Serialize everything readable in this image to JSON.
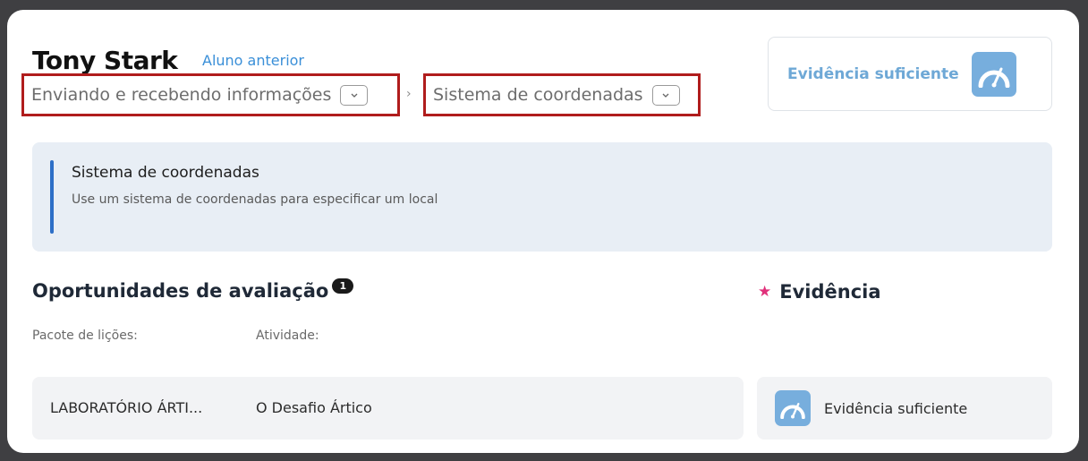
{
  "student": {
    "name": "Tony Stark",
    "prev_link": "Aluno anterior"
  },
  "breadcrumb": {
    "level1": "Enviando e recebendo informações",
    "separator": "›",
    "level2": "Sistema de coordenadas",
    "dropdown_icon": "chevron-down-icon"
  },
  "evidence_summary": {
    "label": "Evidência suficiente",
    "icon": "gauge-icon"
  },
  "skill": {
    "title": "Sistema de coordenadas",
    "description": "Use um sistema de coordenadas para especificar um local"
  },
  "assessment": {
    "title": "Oportunidades de avaliação",
    "count": "1",
    "columns": {
      "package": "Pacote de lições:",
      "activity": "Atividade:"
    },
    "rows": [
      {
        "package": "LABORATÓRIO ÁRTI...",
        "activity": "O Desafio Ártico"
      }
    ]
  },
  "evidence": {
    "title": "Evidência",
    "icon": "star-icon",
    "rows": [
      {
        "label": "Evidência suficiente",
        "icon": "gauge-icon"
      }
    ]
  },
  "colors": {
    "accent": "#2d6fc7",
    "link": "#3a8fd8",
    "gauge_tile": "#77aedd",
    "highlight_border": "#b01c1c",
    "star": "#e0307a"
  }
}
